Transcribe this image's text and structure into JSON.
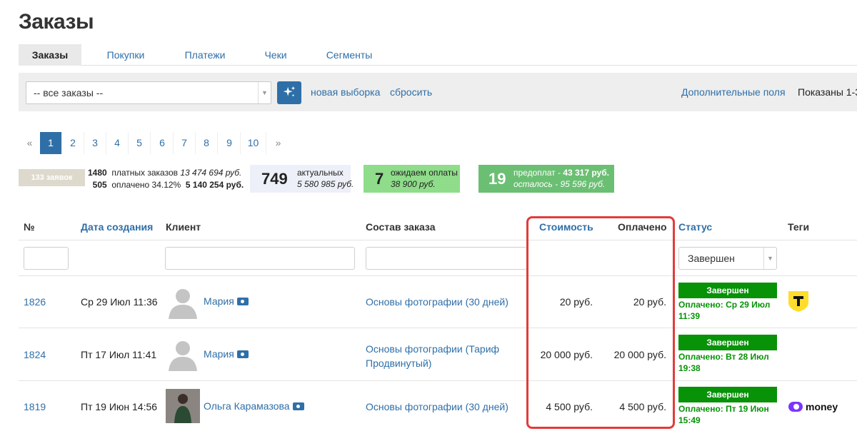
{
  "page": {
    "title": "Заказы"
  },
  "tabs": [
    {
      "label": "Заказы",
      "active": true
    },
    {
      "label": "Покупки"
    },
    {
      "label": "Платежи"
    },
    {
      "label": "Чеки"
    },
    {
      "label": "Сегменты"
    }
  ],
  "toolbar": {
    "filter_select": "-- все заказы --",
    "new_selection": "новая выборка",
    "reset": "сбросить",
    "extra_fields": "Дополнительные поля",
    "shown": "Показаны 1-3"
  },
  "pagination": {
    "prev": "«",
    "next": "»",
    "pages": [
      "1",
      "2",
      "3",
      "4",
      "5",
      "6",
      "7",
      "8",
      "9",
      "10"
    ],
    "current": "1"
  },
  "stats": {
    "requests": "133 заявок",
    "paid_count": "1480",
    "paid_label": "платных заказов",
    "paid_sum": "13 474 694 руб.",
    "paid_done_count": "505",
    "paid_done_label": "оплачено 34.12%",
    "paid_done_sum": "5 140 254 руб.",
    "actual_count": "749",
    "actual_label": "актуальных",
    "actual_sum": "5 580 985 руб.",
    "waiting_count": "7",
    "waiting_label": "ожидаем оплаты",
    "waiting_sum": "38 900 руб.",
    "prepay_count": "19",
    "prepay_label": "предоплат - ",
    "prepay_sum": "43 317 руб.",
    "remain_label": "осталось - ",
    "remain_sum": "95 596 руб."
  },
  "table": {
    "headers": {
      "num": "№",
      "created": "Дата создания",
      "client": "Клиент",
      "composition": "Состав заказа",
      "cost": "Стоимость",
      "paid": "Оплачено",
      "status": "Статус",
      "tags": "Теги"
    },
    "status_filter": "Завершен",
    "rows": [
      {
        "id": "1826",
        "date": "Ср 29 Июл 11:36",
        "client": "Мария",
        "item1": "Основы фотографии (30 дней)",
        "item2": "",
        "cost": "20 руб.",
        "paid": "20 руб.",
        "status": "Завершен",
        "paid_line1": "Оплачено: Ср 29 Июл",
        "paid_line2": "11:39",
        "tag": "tbank-logo"
      },
      {
        "id": "1824",
        "date": "Пт 17 Июл 11:41",
        "client": "Мария",
        "item1": "Основы фотографии (Тариф",
        "item2": "Продвинутый)",
        "cost": "20 000 руб.",
        "paid": "20 000 руб.",
        "status": "Завершен",
        "paid_line1": "Оплачено: Вт 28 Июл",
        "paid_line2": "19:38",
        "tag": ""
      },
      {
        "id": "1819",
        "date": "Пт 19 Июн 14:56",
        "client": "Ольга Карамазова",
        "item1": "Основы фотографии (30 дней)",
        "item2": "",
        "cost": "4 500 руб.",
        "paid": "4 500 руб.",
        "status": "Завершен",
        "paid_line1": "Оплачено: Пт 19 Июн",
        "paid_line2": "15:49",
        "tag": "money"
      }
    ]
  },
  "colors": {
    "accent": "#2f6fa8",
    "success": "#079207",
    "highlight": "#e23b3b"
  }
}
